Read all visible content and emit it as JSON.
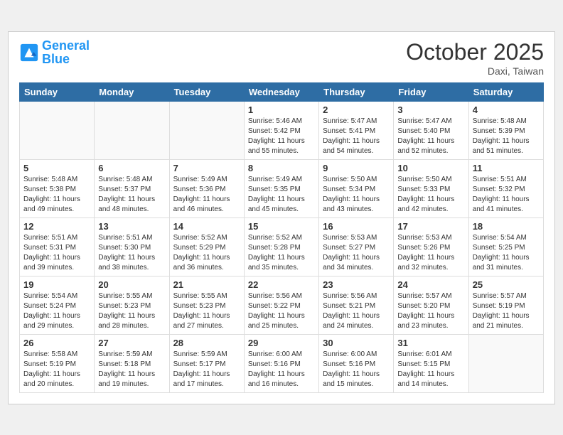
{
  "header": {
    "logo_line1": "General",
    "logo_line2": "Blue",
    "month": "October 2025",
    "location": "Daxi, Taiwan"
  },
  "weekdays": [
    "Sunday",
    "Monday",
    "Tuesday",
    "Wednesday",
    "Thursday",
    "Friday",
    "Saturday"
  ],
  "weeks": [
    [
      {
        "day": "",
        "info": ""
      },
      {
        "day": "",
        "info": ""
      },
      {
        "day": "",
        "info": ""
      },
      {
        "day": "1",
        "info": "Sunrise: 5:46 AM\nSunset: 5:42 PM\nDaylight: 11 hours\nand 55 minutes."
      },
      {
        "day": "2",
        "info": "Sunrise: 5:47 AM\nSunset: 5:41 PM\nDaylight: 11 hours\nand 54 minutes."
      },
      {
        "day": "3",
        "info": "Sunrise: 5:47 AM\nSunset: 5:40 PM\nDaylight: 11 hours\nand 52 minutes."
      },
      {
        "day": "4",
        "info": "Sunrise: 5:48 AM\nSunset: 5:39 PM\nDaylight: 11 hours\nand 51 minutes."
      }
    ],
    [
      {
        "day": "5",
        "info": "Sunrise: 5:48 AM\nSunset: 5:38 PM\nDaylight: 11 hours\nand 49 minutes."
      },
      {
        "day": "6",
        "info": "Sunrise: 5:48 AM\nSunset: 5:37 PM\nDaylight: 11 hours\nand 48 minutes."
      },
      {
        "day": "7",
        "info": "Sunrise: 5:49 AM\nSunset: 5:36 PM\nDaylight: 11 hours\nand 46 minutes."
      },
      {
        "day": "8",
        "info": "Sunrise: 5:49 AM\nSunset: 5:35 PM\nDaylight: 11 hours\nand 45 minutes."
      },
      {
        "day": "9",
        "info": "Sunrise: 5:50 AM\nSunset: 5:34 PM\nDaylight: 11 hours\nand 43 minutes."
      },
      {
        "day": "10",
        "info": "Sunrise: 5:50 AM\nSunset: 5:33 PM\nDaylight: 11 hours\nand 42 minutes."
      },
      {
        "day": "11",
        "info": "Sunrise: 5:51 AM\nSunset: 5:32 PM\nDaylight: 11 hours\nand 41 minutes."
      }
    ],
    [
      {
        "day": "12",
        "info": "Sunrise: 5:51 AM\nSunset: 5:31 PM\nDaylight: 11 hours\nand 39 minutes."
      },
      {
        "day": "13",
        "info": "Sunrise: 5:51 AM\nSunset: 5:30 PM\nDaylight: 11 hours\nand 38 minutes."
      },
      {
        "day": "14",
        "info": "Sunrise: 5:52 AM\nSunset: 5:29 PM\nDaylight: 11 hours\nand 36 minutes."
      },
      {
        "day": "15",
        "info": "Sunrise: 5:52 AM\nSunset: 5:28 PM\nDaylight: 11 hours\nand 35 minutes."
      },
      {
        "day": "16",
        "info": "Sunrise: 5:53 AM\nSunset: 5:27 PM\nDaylight: 11 hours\nand 34 minutes."
      },
      {
        "day": "17",
        "info": "Sunrise: 5:53 AM\nSunset: 5:26 PM\nDaylight: 11 hours\nand 32 minutes."
      },
      {
        "day": "18",
        "info": "Sunrise: 5:54 AM\nSunset: 5:25 PM\nDaylight: 11 hours\nand 31 minutes."
      }
    ],
    [
      {
        "day": "19",
        "info": "Sunrise: 5:54 AM\nSunset: 5:24 PM\nDaylight: 11 hours\nand 29 minutes."
      },
      {
        "day": "20",
        "info": "Sunrise: 5:55 AM\nSunset: 5:23 PM\nDaylight: 11 hours\nand 28 minutes."
      },
      {
        "day": "21",
        "info": "Sunrise: 5:55 AM\nSunset: 5:23 PM\nDaylight: 11 hours\nand 27 minutes."
      },
      {
        "day": "22",
        "info": "Sunrise: 5:56 AM\nSunset: 5:22 PM\nDaylight: 11 hours\nand 25 minutes."
      },
      {
        "day": "23",
        "info": "Sunrise: 5:56 AM\nSunset: 5:21 PM\nDaylight: 11 hours\nand 24 minutes."
      },
      {
        "day": "24",
        "info": "Sunrise: 5:57 AM\nSunset: 5:20 PM\nDaylight: 11 hours\nand 23 minutes."
      },
      {
        "day": "25",
        "info": "Sunrise: 5:57 AM\nSunset: 5:19 PM\nDaylight: 11 hours\nand 21 minutes."
      }
    ],
    [
      {
        "day": "26",
        "info": "Sunrise: 5:58 AM\nSunset: 5:19 PM\nDaylight: 11 hours\nand 20 minutes."
      },
      {
        "day": "27",
        "info": "Sunrise: 5:59 AM\nSunset: 5:18 PM\nDaylight: 11 hours\nand 19 minutes."
      },
      {
        "day": "28",
        "info": "Sunrise: 5:59 AM\nSunset: 5:17 PM\nDaylight: 11 hours\nand 17 minutes."
      },
      {
        "day": "29",
        "info": "Sunrise: 6:00 AM\nSunset: 5:16 PM\nDaylight: 11 hours\nand 16 minutes."
      },
      {
        "day": "30",
        "info": "Sunrise: 6:00 AM\nSunset: 5:16 PM\nDaylight: 11 hours\nand 15 minutes."
      },
      {
        "day": "31",
        "info": "Sunrise: 6:01 AM\nSunset: 5:15 PM\nDaylight: 11 hours\nand 14 minutes."
      },
      {
        "day": "",
        "info": ""
      }
    ]
  ]
}
